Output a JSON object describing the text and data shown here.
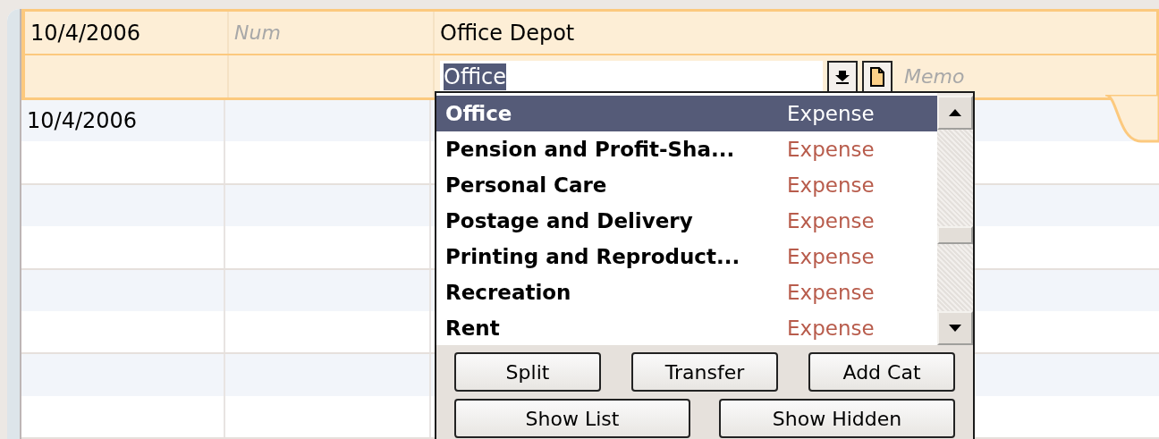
{
  "register": {
    "active_transaction": {
      "date": "10/4/2006",
      "num_placeholder": "Num",
      "payee": "Office Depot",
      "category": "Office",
      "memo_placeholder": "Memo"
    },
    "rows": [
      {
        "date": "10/4/2006"
      }
    ]
  },
  "category_dropdown": {
    "items": [
      {
        "name": "Office",
        "type": "Expense",
        "selected": true
      },
      {
        "name": "Pension and Profit-Sha...",
        "type": "Expense",
        "selected": false
      },
      {
        "name": "Personal Care",
        "type": "Expense",
        "selected": false
      },
      {
        "name": "Postage and Delivery",
        "type": "Expense",
        "selected": false
      },
      {
        "name": "Printing and Reproduct...",
        "type": "Expense",
        "selected": false
      },
      {
        "name": "Recreation",
        "type": "Expense",
        "selected": false
      },
      {
        "name": "Rent",
        "type": "Expense",
        "selected": false
      }
    ],
    "button_rows": [
      [
        "Split",
        "Transfer",
        "Add Cat"
      ],
      [
        "Show List",
        "Show Hidden"
      ]
    ]
  }
}
